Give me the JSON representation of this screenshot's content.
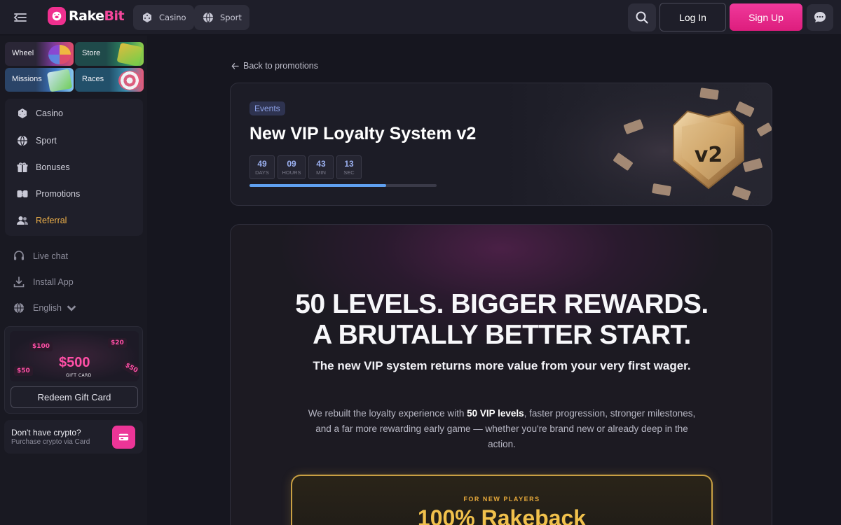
{
  "brand": {
    "name_main": "Rake",
    "name_accent": "Bit"
  },
  "topnav": {
    "casino_label": "Casino",
    "sport_label": "Sport",
    "login_label": "Log In",
    "signup_label": "Sign Up"
  },
  "quick_links": [
    {
      "label": "Wheel"
    },
    {
      "label": "Store"
    },
    {
      "label": "Missions"
    },
    {
      "label": "Races"
    }
  ],
  "nav": [
    {
      "label": "Casino"
    },
    {
      "label": "Sport"
    },
    {
      "label": "Bonuses"
    },
    {
      "label": "Promotions"
    },
    {
      "label": "Referral"
    }
  ],
  "side_links": {
    "live_chat": "Live chat",
    "install_app": "Install App",
    "language": "English"
  },
  "gift_card": {
    "amount": "$500",
    "caption": "GIFT CARD",
    "chips": [
      "$100",
      "$20",
      "$50",
      "$50"
    ],
    "redeem_label": "Redeem Gift Card"
  },
  "crypto": {
    "title": "Don't have crypto?",
    "subtitle": "Purchase crypto via Card"
  },
  "promo": {
    "back_label": "Back to promotions",
    "tag": "Events",
    "title": "New VIP Loyalty System v2",
    "badge_text": "v2",
    "countdown": [
      {
        "value": "49",
        "unit": "DAYS"
      },
      {
        "value": "09",
        "unit": "HOURS"
      },
      {
        "value": "43",
        "unit": "MIN"
      },
      {
        "value": "13",
        "unit": "SEC"
      }
    ],
    "progress": 0.73
  },
  "hero": {
    "headline_1": "50 LEVELS. BIGGER REWARDS.",
    "headline_2": "A BRUTALLY BETTER START.",
    "subheadline": "The new VIP system returns more value from your very first wager.",
    "body_pre": "We rebuilt the loyalty experience with ",
    "body_bold": "50 VIP levels",
    "body_post": ", faster progression, stronger milestones, and a far more rewarding early game — whether you're brand new or already deep in the action.",
    "card_label": "FOR NEW PLAYERS",
    "card_title": "100% Rakeback"
  },
  "colors": {
    "accent_pink": "#ec3597",
    "gold": "#f0b24a",
    "timer_blue": "#9bb0f0"
  }
}
